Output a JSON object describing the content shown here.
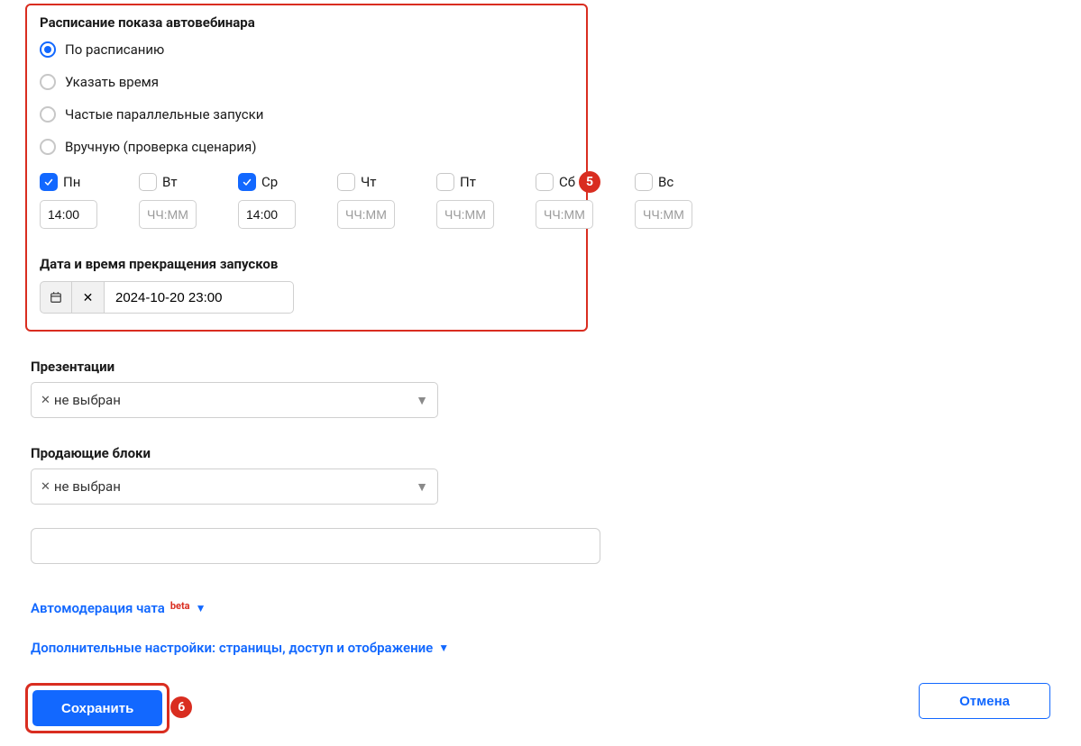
{
  "schedule": {
    "title": "Расписание показа автовебинара",
    "options": [
      {
        "label": "По расписанию",
        "checked": true
      },
      {
        "label": "Указать время",
        "checked": false
      },
      {
        "label": "Частые параллельные запуски",
        "checked": false
      },
      {
        "label": "Вручную (проверка сценария)",
        "checked": false
      }
    ],
    "days": [
      {
        "label": "Пн",
        "checked": true,
        "time": "14:00",
        "placeholder": "ЧЧ:ММ"
      },
      {
        "label": "Вт",
        "checked": false,
        "time": "",
        "placeholder": "ЧЧ:ММ"
      },
      {
        "label": "Ср",
        "checked": true,
        "time": "14:00",
        "placeholder": "ЧЧ:ММ"
      },
      {
        "label": "Чт",
        "checked": false,
        "time": "",
        "placeholder": "ЧЧ:ММ"
      },
      {
        "label": "Пт",
        "checked": false,
        "time": "",
        "placeholder": "ЧЧ:ММ"
      },
      {
        "label": "Сб",
        "checked": false,
        "time": "",
        "placeholder": "ЧЧ:ММ"
      },
      {
        "label": "Вс",
        "checked": false,
        "time": "",
        "placeholder": "ЧЧ:ММ"
      }
    ],
    "stop_title": "Дата и время прекращения запусков",
    "stop_value": "2024-10-20 23:00"
  },
  "presentations": {
    "title": "Презентации",
    "chip": "не выбран"
  },
  "selling_blocks": {
    "title": "Продающие блоки",
    "chip": "не выбран"
  },
  "automod": {
    "label": "Автомодерация чата",
    "beta": "beta"
  },
  "extra": {
    "label": "Дополнительные настройки: страницы, доступ и отображение"
  },
  "buttons": {
    "save": "Сохранить",
    "cancel": "Отмена"
  },
  "annotations": {
    "five": "5",
    "six": "6"
  }
}
